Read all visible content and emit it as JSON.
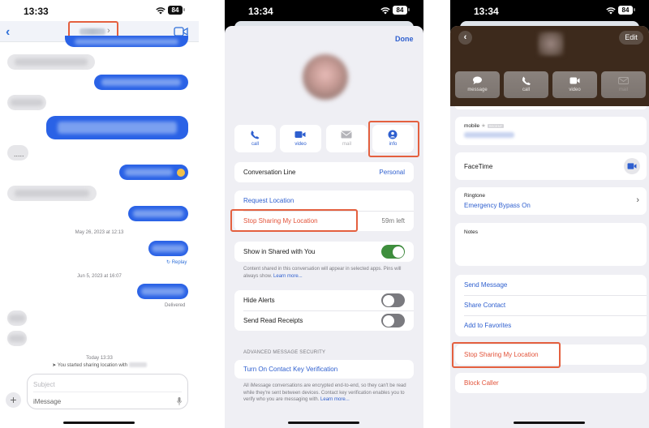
{
  "colors": {
    "accent_blue": "#2e5fcf",
    "outgoing_bubble": "#2a62e6",
    "incoming_bubble": "#e6e6e9",
    "destructive_red": "#e2533a",
    "highlight_box": "#e4603f",
    "toggle_on": "#3e8e3d",
    "contact_header": "#3d2a1c"
  },
  "panel1": {
    "status": {
      "time": "13:33",
      "battery": "84"
    },
    "nav": {
      "back_icon": "chevron-left-icon",
      "contact_name_chevron": "›",
      "facetime_icon": "video-camera-icon"
    },
    "messages": [
      {
        "direction": "out",
        "text": "",
        "blurred": true
      },
      {
        "direction": "in",
        "text": "",
        "blurred": true
      },
      {
        "direction": "out",
        "text": "",
        "blurred": true
      },
      {
        "direction": "in",
        "text": "",
        "blurred": true
      },
      {
        "direction": "out",
        "text": "",
        "blurred": true
      },
      {
        "direction": "in",
        "text": "....."
      },
      {
        "direction": "out",
        "text": "",
        "blurred": true,
        "emoji": "grinning-face"
      },
      {
        "direction": "in",
        "text": "",
        "blurred": true
      },
      {
        "direction": "out",
        "text": "",
        "blurred": true
      }
    ],
    "timestamp1": "May 26, 2023 at 12:13",
    "replay_label": "↻ Replay",
    "timestamp2": "Jun 5, 2023 at 16:07",
    "delivered_label": "Delivered",
    "today_label": "Today 13:33",
    "system_message": "You started sharing location with",
    "compose": {
      "subject_placeholder": "Subject",
      "message_placeholder": "iMessage",
      "plus": "+"
    }
  },
  "panel2": {
    "status": {
      "time": "13:34",
      "battery": "84"
    },
    "done_label": "Done",
    "actions": [
      {
        "label": "call",
        "icon": "phone-icon",
        "enabled": true
      },
      {
        "label": "video",
        "icon": "video-camera-icon",
        "enabled": true
      },
      {
        "label": "mail",
        "icon": "mail-icon",
        "enabled": false
      },
      {
        "label": "info",
        "icon": "person-circle-icon",
        "enabled": true,
        "highlighted": true
      }
    ],
    "conversation_line": {
      "label": "Conversation Line",
      "value": "Personal"
    },
    "request_location": "Request Location",
    "stop_sharing": {
      "label": "Stop Sharing My Location",
      "value": "59m left"
    },
    "shared_with_you": {
      "label": "Show in Shared with You",
      "enabled": true
    },
    "shared_footnote": "Content shared in this conversation will appear in selected apps. Pins will always show.",
    "learn_more": "Learn more...",
    "hide_alerts": {
      "label": "Hide Alerts",
      "enabled": false
    },
    "read_receipts": {
      "label": "Send Read Receipts",
      "enabled": false
    },
    "security_header": "ADVANCED MESSAGE SECURITY",
    "contact_key": "Turn On Contact Key Verification",
    "security_footnote": "All iMessage conversations are encrypted end-to-end, so they can't be read while they're sent between devices. Contact key verification enables you to verify who you are messaging with."
  },
  "panel3": {
    "status": {
      "time": "13:34",
      "battery": "84"
    },
    "back_icon": "‹",
    "edit_label": "Edit",
    "actions": [
      {
        "label": "message",
        "icon": "message-bubble-icon",
        "enabled": true
      },
      {
        "label": "call",
        "icon": "phone-icon",
        "enabled": true
      },
      {
        "label": "video",
        "icon": "video-camera-icon",
        "enabled": true
      },
      {
        "label": "mail",
        "icon": "mail-icon",
        "enabled": false
      }
    ],
    "phone": {
      "label": "mobile",
      "star": "★",
      "badge": "RECENT"
    },
    "facetime_label": "FaceTime",
    "ringtone": {
      "label": "Ringtone",
      "value": "Emergency Bypass On",
      "chevron": "›"
    },
    "notes_label": "Notes",
    "links": [
      "Send Message",
      "Share Contact",
      "Add to Favorites"
    ],
    "stop_sharing": "Stop Sharing My Location",
    "block_caller": "Block Caller"
  }
}
